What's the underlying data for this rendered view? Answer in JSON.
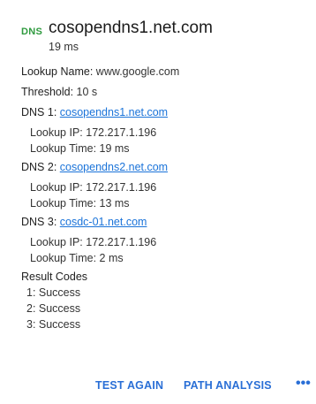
{
  "header": {
    "badge": "DNS",
    "title": "cosopendns1.net.com",
    "subtitle": "19 ms"
  },
  "lookup_name": {
    "label": "Lookup Name:",
    "value": "www.google.com"
  },
  "threshold": {
    "label": "Threshold:",
    "value": "10 s"
  },
  "servers": [
    {
      "label": "DNS 1:",
      "host": "cosopendns1.net.com",
      "ip_line": "Lookup IP:  172.217.1.196",
      "time_line": "Lookup Time:  19 ms"
    },
    {
      "label": "DNS 2:",
      "host": "cosopendns2.net.com",
      "ip_line": "Lookup IP:  172.217.1.196",
      "time_line": "Lookup Time:  13 ms"
    },
    {
      "label": "DNS 3:",
      "host": "cosdc-01.net.com",
      "ip_line": "Lookup IP:  172.217.1.196",
      "time_line": "Lookup Time:  2 ms"
    }
  ],
  "result_codes": {
    "title": "Result Codes",
    "items": [
      "1: Success",
      "2: Success",
      "3: Success"
    ]
  },
  "actions": {
    "test_again": "TEST AGAIN",
    "path_analysis": "PATH ANALYSIS",
    "more": "•••"
  },
  "colors": {
    "badge": "#2e9a3e",
    "link": "#1a73d9",
    "action": "#2a6fd6"
  }
}
